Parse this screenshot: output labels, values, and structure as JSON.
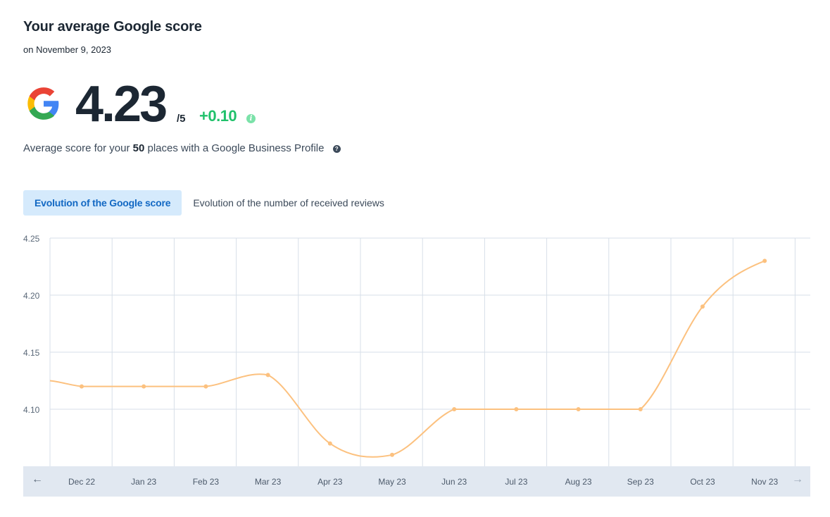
{
  "header": {
    "title": "Your average Google score",
    "date": "on November 9, 2023"
  },
  "score": {
    "value": "4.23",
    "max": "/5",
    "delta": "+0.10",
    "delta_color": "#20c16b"
  },
  "description": {
    "prefix": "Average score for your ",
    "count": "50",
    "suffix": " places with a Google Business Profile"
  },
  "icons": {
    "brand": "google-g-icon",
    "delta_info": "info-icon",
    "description_help": "question-icon",
    "prev": "arrow-left-icon",
    "next": "arrow-right-icon"
  },
  "tabs": [
    {
      "label": "Evolution of the Google score",
      "active": true
    },
    {
      "label": "Evolution of the number of received reviews",
      "active": false
    }
  ],
  "navigation": {
    "prev_arrow": "←",
    "next_arrow": "→",
    "next_disabled": true
  },
  "chart_data": {
    "type": "line",
    "title": "Evolution of the Google score",
    "xlabel": "",
    "ylabel": "",
    "categories": [
      "Dec 22",
      "Jan 23",
      "Feb 23",
      "Mar 23",
      "Apr 23",
      "May 23",
      "Jun 23",
      "Jul 23",
      "Aug 23",
      "Sep 23",
      "Oct 23",
      "Nov 23"
    ],
    "series": [
      {
        "name": "Google score",
        "color": "#fcc17f",
        "leading_value": 4.125,
        "values": [
          4.12,
          4.12,
          4.12,
          4.13,
          4.07,
          4.06,
          4.1,
          4.1,
          4.1,
          4.1,
          4.19,
          4.23
        ]
      }
    ],
    "ylim": [
      4.05,
      4.25
    ],
    "yticks": [
      "4.25",
      "4.20",
      "4.15",
      "4.10"
    ],
    "ytick_values": [
      4.25,
      4.2,
      4.15,
      4.1
    ],
    "grid": true,
    "smooth": true,
    "legend": "none"
  }
}
